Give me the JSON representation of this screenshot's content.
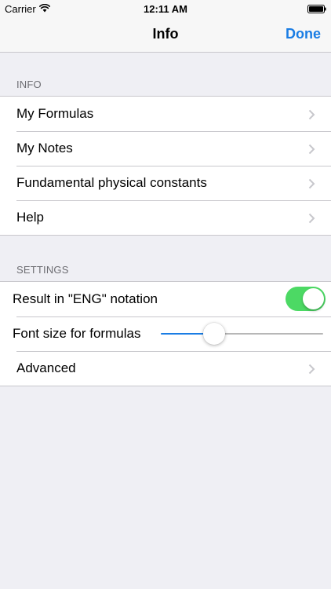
{
  "status_bar": {
    "carrier": "Carrier",
    "time": "12:11 AM",
    "wifi_icon": "wifi-icon",
    "battery_icon": "battery-icon"
  },
  "nav": {
    "title": "Info",
    "done_label": "Done"
  },
  "colors": {
    "accent": "#1a7de4",
    "toggle_on": "#4cd964",
    "background": "#efeff4"
  },
  "info_section": {
    "header": "INFO",
    "items": [
      {
        "label": "My Formulas",
        "icon": "chevron-right-icon"
      },
      {
        "label": "My Notes",
        "icon": "chevron-right-icon"
      },
      {
        "label": "Fundamental physical constants",
        "icon": "chevron-right-icon"
      },
      {
        "label": "Help",
        "icon": "chevron-right-icon"
      }
    ]
  },
  "settings_section": {
    "header": "SETTINGS",
    "eng_notation": {
      "label": "Result in \"ENG\" notation",
      "enabled": true
    },
    "font_size": {
      "label": "Font size for formulas",
      "value_fraction": 0.33
    },
    "advanced": {
      "label": "Advanced",
      "icon": "chevron-right-icon"
    }
  }
}
